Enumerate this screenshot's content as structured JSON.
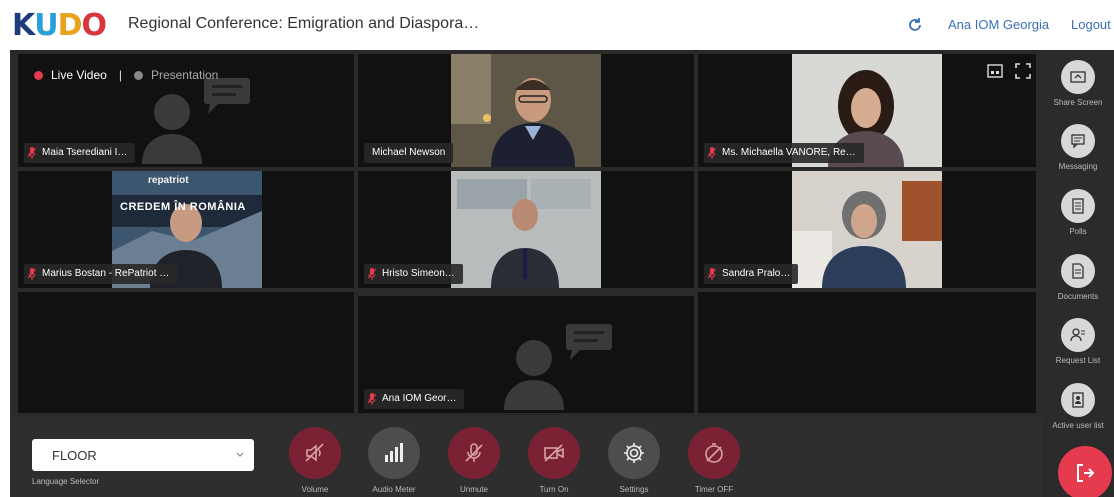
{
  "header": {
    "logo_letters": [
      "K",
      "U",
      "D",
      "O"
    ],
    "title": "Regional Conference: Emigration and Diaspora…",
    "user": "Ana IOM Georgia",
    "logout": "Logout"
  },
  "view_switch": {
    "live": "Live Video",
    "separator": "|",
    "presentation": "Presentation"
  },
  "participants": [
    {
      "name": "Maia Tserediani I…",
      "video": false
    },
    {
      "name": "Michael Newson",
      "video": true
    },
    {
      "name": "Ms. Michaella VANORE, Re…",
      "video": true
    },
    {
      "name": "Marius Bostan - RePatriot …",
      "video": true
    },
    {
      "name": "Hristo Simeon…",
      "video": true
    },
    {
      "name": "Sandra Pralo…",
      "video": true
    },
    {
      "name": "Ana IOM Geor…",
      "video": false
    }
  ],
  "video_overlay": {
    "brand": "repatriot",
    "banner": "CREDEM ÎN ROMÂNIA"
  },
  "sidebar": [
    {
      "label": "Share Screen",
      "icon": "share-screen-icon"
    },
    {
      "label": "Messaging",
      "icon": "messaging-icon"
    },
    {
      "label": "Polls",
      "icon": "polls-icon"
    },
    {
      "label": "Documents",
      "icon": "documents-icon"
    },
    {
      "label": "Request List",
      "icon": "request-list-icon"
    },
    {
      "label": "Active user list",
      "icon": "active-user-list-icon"
    }
  ],
  "controls": {
    "language_value": "FLOOR",
    "language_label": "Language Selector",
    "buttons": [
      {
        "label": "Volume",
        "icon": "volume-muted-icon",
        "style": "red"
      },
      {
        "label": "Audio Meter",
        "icon": "audio-meter-icon",
        "style": "grey"
      },
      {
        "label": "Unmute",
        "icon": "mic-off-icon",
        "style": "red"
      },
      {
        "label": "Turn On",
        "icon": "camera-off-icon",
        "style": "red"
      },
      {
        "label": "Settings",
        "icon": "gear-icon",
        "style": "grey"
      },
      {
        "label": "Timer OFF",
        "icon": "timer-off-icon",
        "style": "red"
      }
    ]
  },
  "colors": {
    "accent_red": "#e63a4e",
    "link_blue": "#3b6fb6",
    "live_dot": "#e63a4e"
  }
}
